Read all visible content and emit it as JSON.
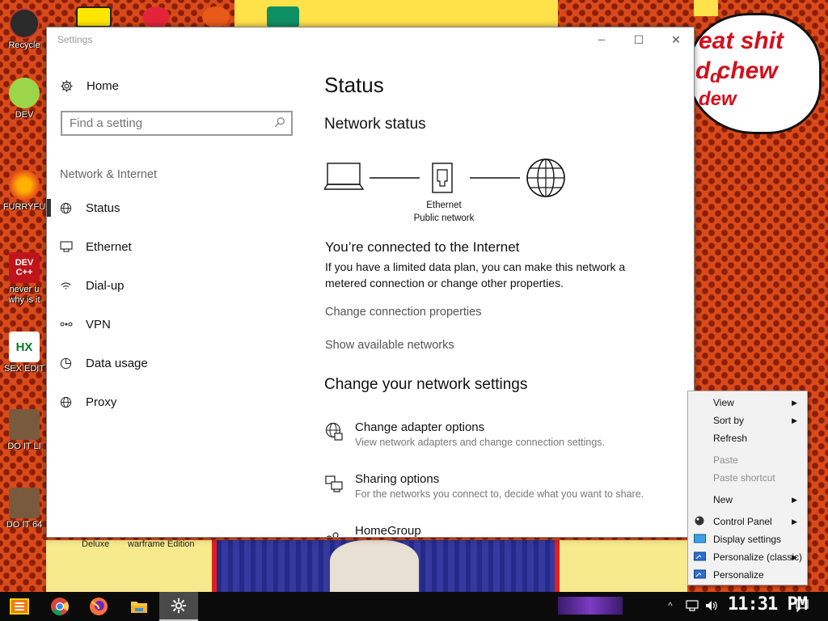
{
  "desktop": {
    "speech_lines": [
      "eat shit",
      "d chew",
      "d",
      "dew"
    ],
    "icons": [
      {
        "label": "Recycle"
      },
      {
        "label": "DEV"
      },
      {
        "label": "FURRYFU"
      },
      {
        "label": "never u"
      },
      {
        "label": "why is it"
      },
      {
        "label": "SEX EDIT"
      },
      {
        "label": "DO IT LI"
      },
      {
        "label": "DO IT 64"
      }
    ],
    "icon_glyphs": {
      "devcpp": "DEV C++",
      "hx": "HX"
    },
    "captions": [
      "Deluxe",
      "warframe Edition"
    ]
  },
  "window": {
    "title": "Settings",
    "controls": {
      "minimize": "─",
      "maximize": "☐",
      "close": "✕"
    }
  },
  "nav": {
    "home": "Home",
    "search_placeholder": "Find a setting",
    "section": "Network & Internet",
    "items": [
      {
        "label": "Status",
        "icon": "globe-icon",
        "active": true
      },
      {
        "label": "Ethernet",
        "icon": "ethernet-icon"
      },
      {
        "label": "Dial-up",
        "icon": "dialup-icon"
      },
      {
        "label": "VPN",
        "icon": "vpn-icon"
      },
      {
        "label": "Data usage",
        "icon": "data-usage-icon"
      },
      {
        "label": "Proxy",
        "icon": "globe-icon"
      }
    ]
  },
  "content": {
    "title": "Status",
    "network_status_heading": "Network status",
    "adapter_name": "Ethernet",
    "network_type": "Public network",
    "connected_heading": "You’re connected to the Internet",
    "connected_desc": "If you have a limited data plan, you can make this network a metered connection or change other properties.",
    "link_change_properties": "Change connection properties",
    "link_show_networks": "Show available networks",
    "change_settings_heading": "Change your network settings",
    "options": [
      {
        "title": "Change adapter options",
        "subtitle": "View network adapters and change connection settings."
      },
      {
        "title": "Sharing options",
        "subtitle": "For the networks you connect to, decide what you want to share."
      },
      {
        "title": "HomeGroup",
        "subtitle": ""
      }
    ]
  },
  "context_menu": {
    "items": [
      {
        "label": "View",
        "submenu": true,
        "disabled": false
      },
      {
        "label": "Sort by",
        "submenu": true,
        "disabled": false
      },
      {
        "label": "Refresh",
        "submenu": false,
        "disabled": false
      },
      {
        "label": "Paste",
        "submenu": false,
        "disabled": true
      },
      {
        "label": "Paste shortcut",
        "submenu": false,
        "disabled": true
      },
      {
        "label": "New",
        "submenu": true,
        "disabled": false
      },
      {
        "label": "Control Panel",
        "submenu": true,
        "disabled": false,
        "icon": "control-panel-icon"
      },
      {
        "label": "Display settings",
        "submenu": false,
        "disabled": false,
        "icon": "display-icon"
      },
      {
        "label": "Personalize (classic)",
        "submenu": true,
        "disabled": false,
        "icon": "personalize-icon"
      },
      {
        "label": "Personalize",
        "submenu": false,
        "disabled": false,
        "icon": "personalize-icon"
      }
    ],
    "submenu_arrow": "▶"
  },
  "taskbar": {
    "clock": "11:31 PM",
    "tray_chevron": "^",
    "accent": "#4a4a4a"
  },
  "colors": {
    "desktop_bg": "#d94a1a",
    "window_bg": "#ffffff",
    "taskbar_bg": "#0b0b0b",
    "speech_text": "#d4101c"
  }
}
